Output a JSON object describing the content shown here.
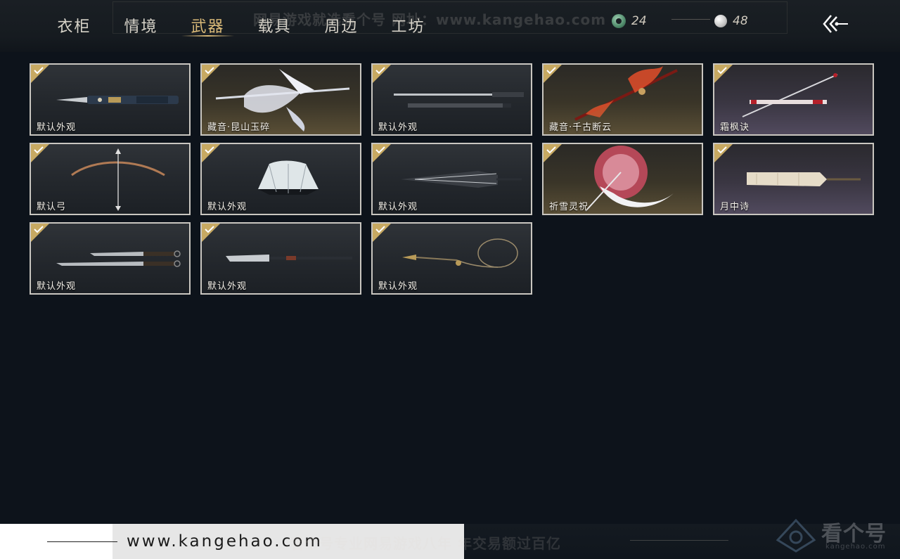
{
  "tabs": [
    {
      "label": "衣柜",
      "active": false
    },
    {
      "label": "情境",
      "active": false
    },
    {
      "label": "武器",
      "active": true
    },
    {
      "label": "载具",
      "active": false
    },
    {
      "label": "周边",
      "active": false
    },
    {
      "label": "工坊",
      "active": false
    }
  ],
  "watermark_top": "网易游戏就选看个号  网址：www.kangehao.com",
  "currency": {
    "jade": {
      "icon": "jade-coin-icon",
      "value": "24"
    },
    "silver": {
      "icon": "silver-coin-icon",
      "value": "48"
    }
  },
  "back_icon": "back-arrow-icon",
  "weapons": [
    {
      "name": "默认外观",
      "equipped": true,
      "icon": "sword-icon",
      "tier": "normal"
    },
    {
      "name": "藏音·昆山玉碎",
      "equipped": true,
      "icon": "phoenix-spear-icon",
      "tier": "gold"
    },
    {
      "name": "默认外观",
      "equipped": true,
      "icon": "twin-sword-icon",
      "tier": "normal"
    },
    {
      "name": "藏音·千古断云",
      "equipped": true,
      "icon": "flame-spear-icon",
      "tier": "gold"
    },
    {
      "name": "霜枫诀",
      "equipped": true,
      "icon": "katana-icon",
      "tier": "purple"
    },
    {
      "name": "默认弓",
      "equipped": true,
      "icon": "bow-icon",
      "tier": "normal"
    },
    {
      "name": "默认外观",
      "equipped": true,
      "icon": "fan-icon",
      "tier": "normal"
    },
    {
      "name": "默认外观",
      "equipped": true,
      "icon": "umbrella-icon",
      "tier": "normal"
    },
    {
      "name": "祈雪灵祝",
      "equipped": true,
      "icon": "feather-umbrella-icon",
      "tier": "gold"
    },
    {
      "name": "月中诗",
      "equipped": true,
      "icon": "paper-umbrella-icon",
      "tier": "purple"
    },
    {
      "name": "默认外观",
      "equipped": true,
      "icon": "dual-blades-icon",
      "tier": "normal"
    },
    {
      "name": "默认外观",
      "equipped": true,
      "icon": "glaive-icon",
      "tier": "normal"
    },
    {
      "name": "默认外观",
      "equipped": true,
      "icon": "rope-dart-icon",
      "tier": "normal"
    }
  ],
  "footer": {
    "url": "www.kangehao.com",
    "slogan": "看个号专业网易游戏八年  年交易额过百亿",
    "brand": "看个号",
    "brand_sub": "kangehao.com"
  },
  "colors": {
    "background": "#0d131b",
    "accent_gold": "#d9b978",
    "card_border": "#c9c6c0",
    "check_badge": "#c7a962"
  }
}
